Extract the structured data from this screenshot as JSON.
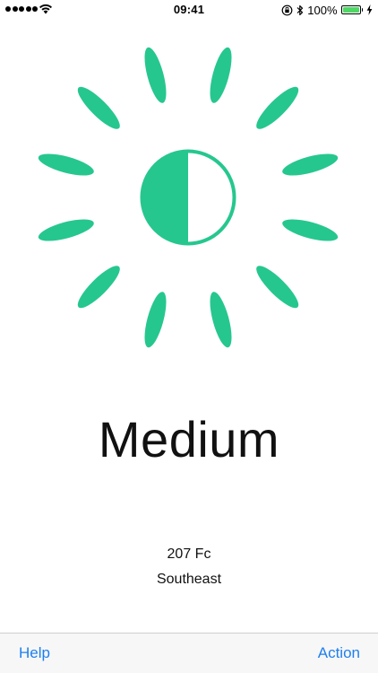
{
  "status_bar": {
    "time": "09:41",
    "battery_percent": "100%",
    "signal_strength": 5,
    "battery_level": 1.0,
    "icons": [
      "signal-dots",
      "wifi-icon",
      "orientation-lock-icon",
      "bluetooth-icon",
      "battery-icon",
      "charging-bolt-icon"
    ]
  },
  "indicator": {
    "icon": "sun-half-moon-icon",
    "accent_color": "#26c78f"
  },
  "light": {
    "level": "Medium",
    "reading": "207 Fc",
    "direction": "Southeast"
  },
  "toolbar": {
    "help_label": "Help",
    "action_label": "Action",
    "link_color": "#1e7ff0"
  }
}
